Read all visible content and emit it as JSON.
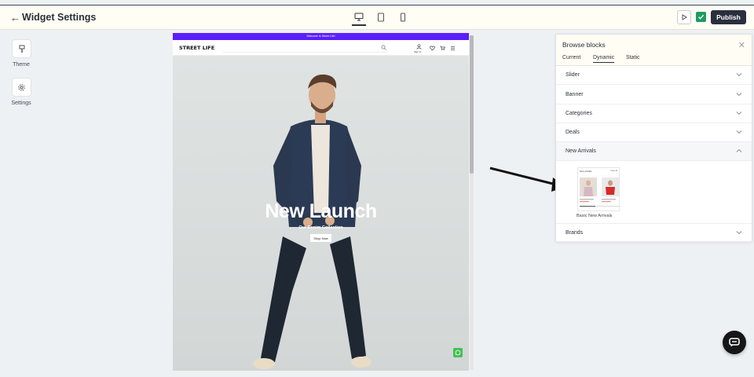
{
  "header": {
    "title": "Widget Settings",
    "publish_label": "Publish"
  },
  "sidebar": {
    "items": [
      {
        "label": "Theme",
        "icon": "brush-icon"
      },
      {
        "label": "Settings",
        "icon": "gear-icon"
      }
    ]
  },
  "preview": {
    "promo_text": "Welcome to Street Life!",
    "brand": "STREET LIFE",
    "signin": "Sign In",
    "hero_title": "New Launch",
    "hero_subtitle": "Our Denim Collection",
    "shop_button": "Shop Now"
  },
  "panel": {
    "title": "Browse blocks",
    "tabs": [
      "Current",
      "Dynamic",
      "Static"
    ],
    "active_tab": "Dynamic",
    "blocks": [
      "Slider",
      "Banner",
      "Categories",
      "Deals",
      "New Arrivals",
      "Brands"
    ],
    "expanded_block": "New Arrivals",
    "preview_caption": "Basic New Arrivals",
    "thumb_heading": "New arrivals",
    "thumb_link": "View all"
  },
  "colors": {
    "accent": "#5b1ffb",
    "publish_bg": "#2a2e3d",
    "check": "#1e9b63",
    "whatsapp": "#43c055"
  }
}
